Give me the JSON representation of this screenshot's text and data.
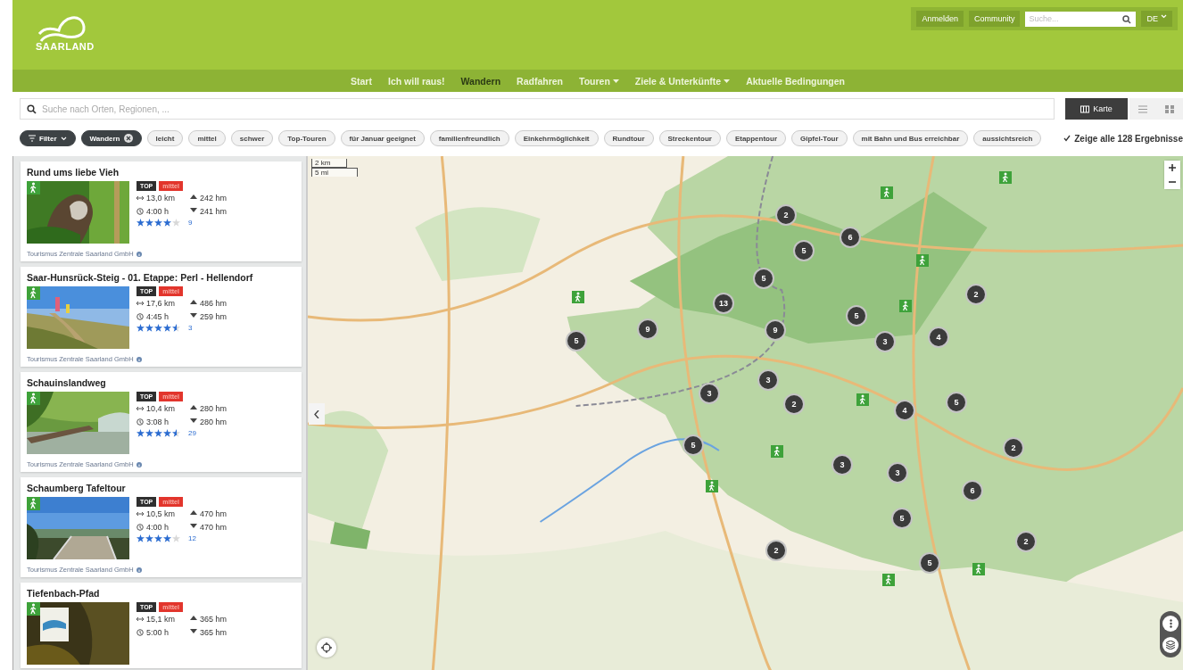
{
  "logo": {
    "text": "SAARLAND"
  },
  "top_bar": {
    "buttons": [
      "Anmelden",
      "Community"
    ],
    "search": {
      "placeholder": "Suche..."
    },
    "language": "DE"
  },
  "nav": [
    {
      "label": "Start",
      "selected": false,
      "dropdown": false
    },
    {
      "label": "Ich will raus!",
      "selected": false,
      "dropdown": false
    },
    {
      "label": "Wandern",
      "selected": true,
      "dropdown": false
    },
    {
      "label": "Radfahren",
      "selected": false,
      "dropdown": false
    },
    {
      "label": "Touren",
      "selected": false,
      "dropdown": true
    },
    {
      "label": "Ziele & Unterkünfte",
      "selected": false,
      "dropdown": true
    },
    {
      "label": "Aktuelle Bedingungen",
      "selected": false,
      "dropdown": false
    }
  ],
  "search": {
    "placeholder": "Suche nach Orten, Regionen, ..."
  },
  "views": [
    {
      "kind": "map",
      "label": "Karte",
      "selected": true
    },
    {
      "kind": "list",
      "selected": false
    },
    {
      "kind": "grid",
      "selected": false
    }
  ],
  "filters": [
    {
      "kind": "menu",
      "label": "Filter"
    },
    {
      "kind": "active",
      "label": "Wandern"
    },
    {
      "kind": "tag",
      "label": "leicht"
    },
    {
      "kind": "tag",
      "label": "mittel"
    },
    {
      "kind": "tag",
      "label": "schwer"
    },
    {
      "kind": "tag",
      "label": "Top-Touren"
    },
    {
      "kind": "tag",
      "label": "für Januar geeignet"
    },
    {
      "kind": "tag",
      "label": "familienfreundlich"
    },
    {
      "kind": "tag",
      "label": "Einkehrmöglichkeit"
    },
    {
      "kind": "tag",
      "label": "Rundtour"
    },
    {
      "kind": "tag",
      "label": "Streckentour"
    },
    {
      "kind": "tag",
      "label": "Etappentour"
    },
    {
      "kind": "tag",
      "label": "Gipfel-Tour"
    },
    {
      "kind": "tag",
      "label": "mit Bahn und Bus erreichbar"
    },
    {
      "kind": "tag",
      "label": "aussichtsreich"
    }
  ],
  "show_all": {
    "checked": true,
    "text": "Zeige alle **128** Ergebnisse"
  },
  "tours": [
    {
      "title": "Rund ums liebe Vieh",
      "badges": [
        "TOP",
        "mittel"
      ],
      "distance": "13,0 km",
      "duration": "4:00 h",
      "ascent": "242 hm",
      "descent": "241 hm",
      "stars": 4,
      "rating_count": "9",
      "author": "Tourismus Zentrale Saarland GmbH"
    },
    {
      "title": "Saar-Hunsrück-Steig - 01. Etappe: Perl - Hellendorf",
      "badges": [
        "TOP",
        "mittel"
      ],
      "distance": "17,6 km",
      "duration": "4:45 h",
      "ascent": "486 hm",
      "descent": "259 hm",
      "stars": 4.5,
      "rating_count": "3",
      "author": "Tourismus Zentrale Saarland GmbH"
    },
    {
      "title": "Schauinslandweg",
      "badges": [
        "TOP",
        "mittel"
      ],
      "distance": "10,4 km",
      "duration": "3:08 h",
      "ascent": "280 hm",
      "descent": "280 hm",
      "stars": 4.5,
      "rating_count": "29",
      "author": "Tourismus Zentrale Saarland GmbH"
    },
    {
      "title": "Schaumberg Tafeltour",
      "badges": [
        "TOP",
        "mittel"
      ],
      "distance": "10,5 km",
      "duration": "4:00 h",
      "ascent": "470 hm",
      "descent": "470 hm",
      "stars": 4,
      "rating_count": "12",
      "author": "Tourismus Zentrale Saarland GmbH"
    },
    {
      "title": "Tiefenbach-Pfad",
      "badges": [
        "TOP",
        "mittel"
      ],
      "distance": "15,1 km",
      "duration": "5:00 h",
      "ascent": "365 hm",
      "descent": "365 hm"
    }
  ],
  "map": {
    "scale": [
      "2 km",
      "5 mi"
    ],
    "clusters": [
      "13",
      "2",
      "6",
      "5",
      "5",
      "9",
      "5",
      "9",
      "5",
      "3",
      "4",
      "2",
      "3",
      "3",
      "2",
      "4",
      "5",
      "5",
      "3",
      "3",
      "2",
      "6",
      "5",
      "2",
      "5",
      "2"
    ]
  }
}
